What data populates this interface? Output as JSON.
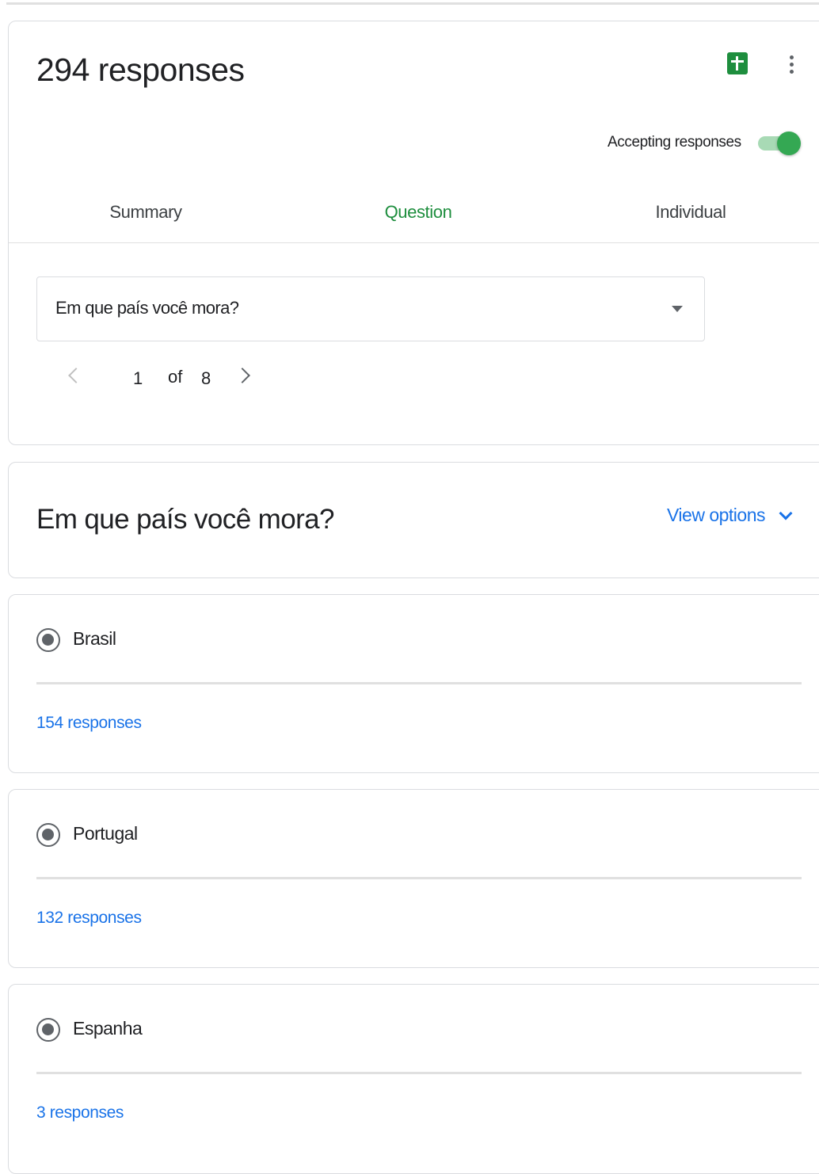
{
  "header": {
    "responses_title": "294 responses",
    "sheets_icon": "google-sheets-icon",
    "more_icon": "more-vert-icon",
    "accepting_label": "Accepting responses",
    "accepting_on": true,
    "accent_color": "#1e8e3e"
  },
  "tabs": [
    {
      "label": "Summary",
      "active": false
    },
    {
      "label": "Question",
      "active": true
    },
    {
      "label": "Individual",
      "active": false
    }
  ],
  "question_select": {
    "value": "Em que país você mora?"
  },
  "pager": {
    "current": "1",
    "of_label": "of",
    "total": "8"
  },
  "question_card": {
    "title": "Em que país você mora?",
    "view_options_label": "View options"
  },
  "answers": [
    {
      "label": "Brasil",
      "count_label": "154 responses"
    },
    {
      "label": "Portugal",
      "count_label": "132 responses"
    },
    {
      "label": "Espanha",
      "count_label": "3 responses"
    }
  ],
  "link_color": "#1a73e8"
}
